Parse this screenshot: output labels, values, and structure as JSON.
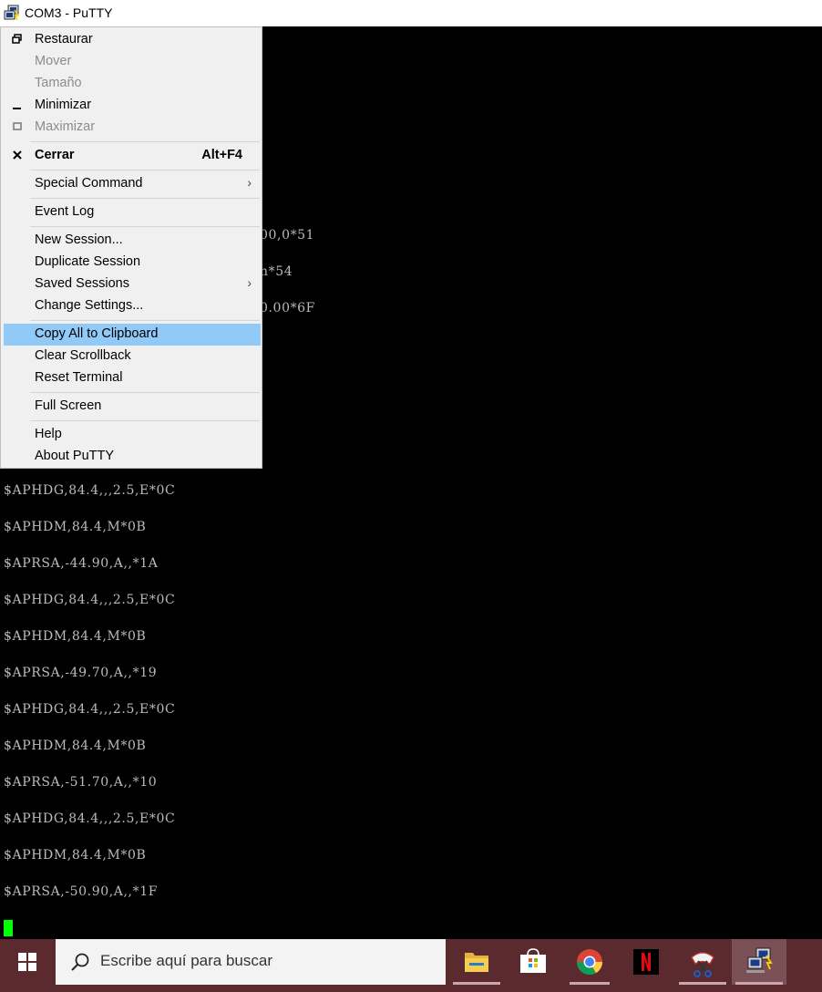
{
  "window": {
    "title": "COM3 - PuTTY",
    "icon": "putty-icon"
  },
  "terminal": {
    "background": "#000000",
    "text_color": "#bbbbbb",
    "cursor_color": "#00ff00",
    "partial_lines": [
      "00,0*51",
      "n*54",
      "0.00*6F"
    ],
    "lines": [
      "$APHDG,84.4,,,2.5,E*0C",
      "$APHDM,84.4,M*0B",
      "$APRSA,-44.90,A,,*1A",
      "$APHDG,84.4,,,2.5,E*0C",
      "$APHDM,84.4,M*0B",
      "$APRSA,-49.70,A,,*19",
      "$APHDG,84.4,,,2.5,E*0C",
      "$APHDM,84.4,M*0B",
      "$APRSA,-51.70,A,,*10",
      "$APHDG,84.4,,,2.5,E*0C",
      "$APHDM,84.4,M*0B",
      "$APRSA,-50.90,A,,*1F"
    ]
  },
  "system_menu": {
    "items": [
      {
        "label": "Restaurar",
        "icon": "restore-icon",
        "enabled": true
      },
      {
        "label": "Mover",
        "enabled": false
      },
      {
        "label": "Tamaño",
        "enabled": false
      },
      {
        "label": "Minimizar",
        "icon": "minimize-icon",
        "enabled": true
      },
      {
        "label": "Maximizar",
        "icon": "maximize-icon",
        "enabled": false
      },
      {
        "label": "Cerrar",
        "icon": "close-icon",
        "accelerator": "Alt+F4",
        "enabled": true
      },
      {
        "label": "Special Command",
        "submenu": true
      },
      {
        "label": "Event Log"
      },
      {
        "label": "New Session..."
      },
      {
        "label": "Duplicate Session"
      },
      {
        "label": "Saved Sessions",
        "submenu": true
      },
      {
        "label": "Change Settings..."
      },
      {
        "label": "Copy All to Clipboard",
        "highlighted": true
      },
      {
        "label": "Clear Scrollback"
      },
      {
        "label": "Reset Terminal"
      },
      {
        "label": "Full Screen"
      },
      {
        "label": "Help"
      },
      {
        "label": "About PuTTY"
      }
    ],
    "highlight_color": "#91c9f7"
  },
  "taskbar": {
    "background": "#5a2a2f",
    "search_placeholder": "Escribe aquí para buscar",
    "apps": [
      {
        "icon": "file-explorer-icon"
      },
      {
        "icon": "microsoft-store-icon"
      },
      {
        "icon": "chrome-icon"
      },
      {
        "icon": "netflix-icon"
      },
      {
        "icon": "snipping-tool-icon"
      },
      {
        "icon": "putty-icon",
        "active": true
      }
    ]
  }
}
